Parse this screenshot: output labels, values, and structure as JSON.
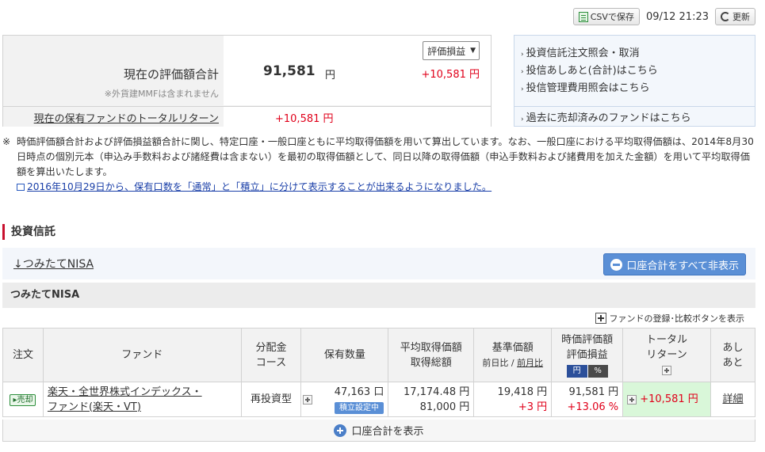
{
  "topbar": {
    "csv_label": "CSVで保存",
    "timestamp": "09/12 21:23",
    "refresh_label": "更新"
  },
  "summary": {
    "total_label": "現在の評価額合計",
    "total_note": "※外貨建MMFは含まれません",
    "total_value": "91,581",
    "total_unit": "円",
    "select_value": "評価損益",
    "total_diff": "+10,581 円",
    "return_label": "現在の保有ファンドのトータルリターン",
    "return_value": "+10,581 円"
  },
  "links": {
    "items": [
      "投資信託注文照会・取消",
      "投信あしあと(合計)はこちら",
      "投信管理費用照会はこちら"
    ],
    "bottom": "過去に売却済みのファンドはこちら"
  },
  "notes": {
    "mark": "※",
    "text": "時価評価額合計および評価損益額合計に関し、特定口座・一般口座ともに平均取得価額を用いて算出しています。なお、一般口座における平均取得価額は、2014年8月30日時点の個別元本（申込み手数料および諸経費は含まない）を最初の取得価額として、同日以降の取得価額（申込手数料および諸費用を加えた金額）を用いて平均取得価額を算出いたします。",
    "info_link": "2016年10月29日から、保有口数を「通常」と「積立」に分けて表示することが出来るようになりました。"
  },
  "section": {
    "title": "投資信託",
    "tsumitate_link": "↓つみたてNISA",
    "hide_button": "口座合計をすべて非表示",
    "account_header": "つみたてNISA",
    "fund_reg": "ファンドの登録･比較ボタンを表示"
  },
  "table": {
    "headers": {
      "order": "注文",
      "fund": "ファンド",
      "dist1": "分配金",
      "dist2": "コース",
      "qty": "保有数量",
      "avg1": "平均取得価額",
      "avg2": "取得総額",
      "base1": "基準価額",
      "base_sub1": "前日比",
      "base_sub_sep": " / ",
      "base_sub2": "前月比",
      "eval1": "時価評価額",
      "eval2": "評価損益",
      "eval_yen": "円",
      "eval_pct": "%",
      "ret1": "トータル",
      "ret2": "リターン",
      "ash1": "あし",
      "ash2": "あと"
    },
    "row": {
      "sell": "売却",
      "fund_name_1": "楽天・全世界株式インデックス・",
      "fund_name_2": "ファンド(楽天・VT)",
      "course": "再投資型",
      "qty": "47,163 口",
      "qty_badge": "積立設定中",
      "avg_price": "17,174.48 円",
      "avg_total": "81,000 円",
      "base_price": "19,418 円",
      "base_diff": "+3 円",
      "eval_value": "91,581 円",
      "eval_pct": "+13.06 %",
      "total_return": "+10,581 円",
      "detail": "詳細"
    }
  },
  "expand": {
    "label": "口座合計を表示"
  },
  "colors": {
    "positive": "#e0001a",
    "accent_blue": "#5a8fd6",
    "section_bar": "#c8102e",
    "total_return_bg": "#d9f7d9"
  }
}
